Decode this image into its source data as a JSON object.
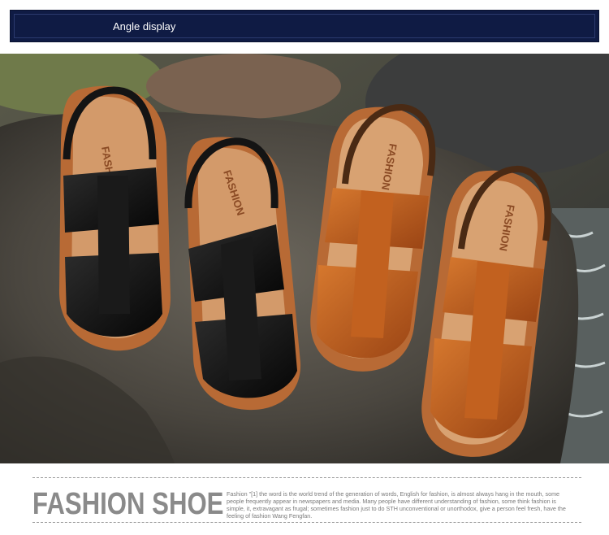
{
  "header": {
    "title": "Angle display"
  },
  "photo": {
    "subject": "four-leather-sandals-on-rock",
    "insole_print": "FASHION",
    "colors": {
      "black_leather": "#121212",
      "brown_leather": "#b5561c",
      "insole": "#c98d5e",
      "rock": "#4d4a45"
    }
  },
  "footer": {
    "brand": "FASHION SHOE",
    "description": "Fashion \"[1] the word is the world trend of the generation of words, English for fashion, is almost always hang in the mouth, some people frequently appear in newspapers and media. Many people have different understanding of fashion, some think fashion is simple, it, extravagant as frugal; sometimes fashion just to do STH unconventional or unorthodox, give a person feel fresh, have the feeling of fashion Wang Fengfan."
  }
}
